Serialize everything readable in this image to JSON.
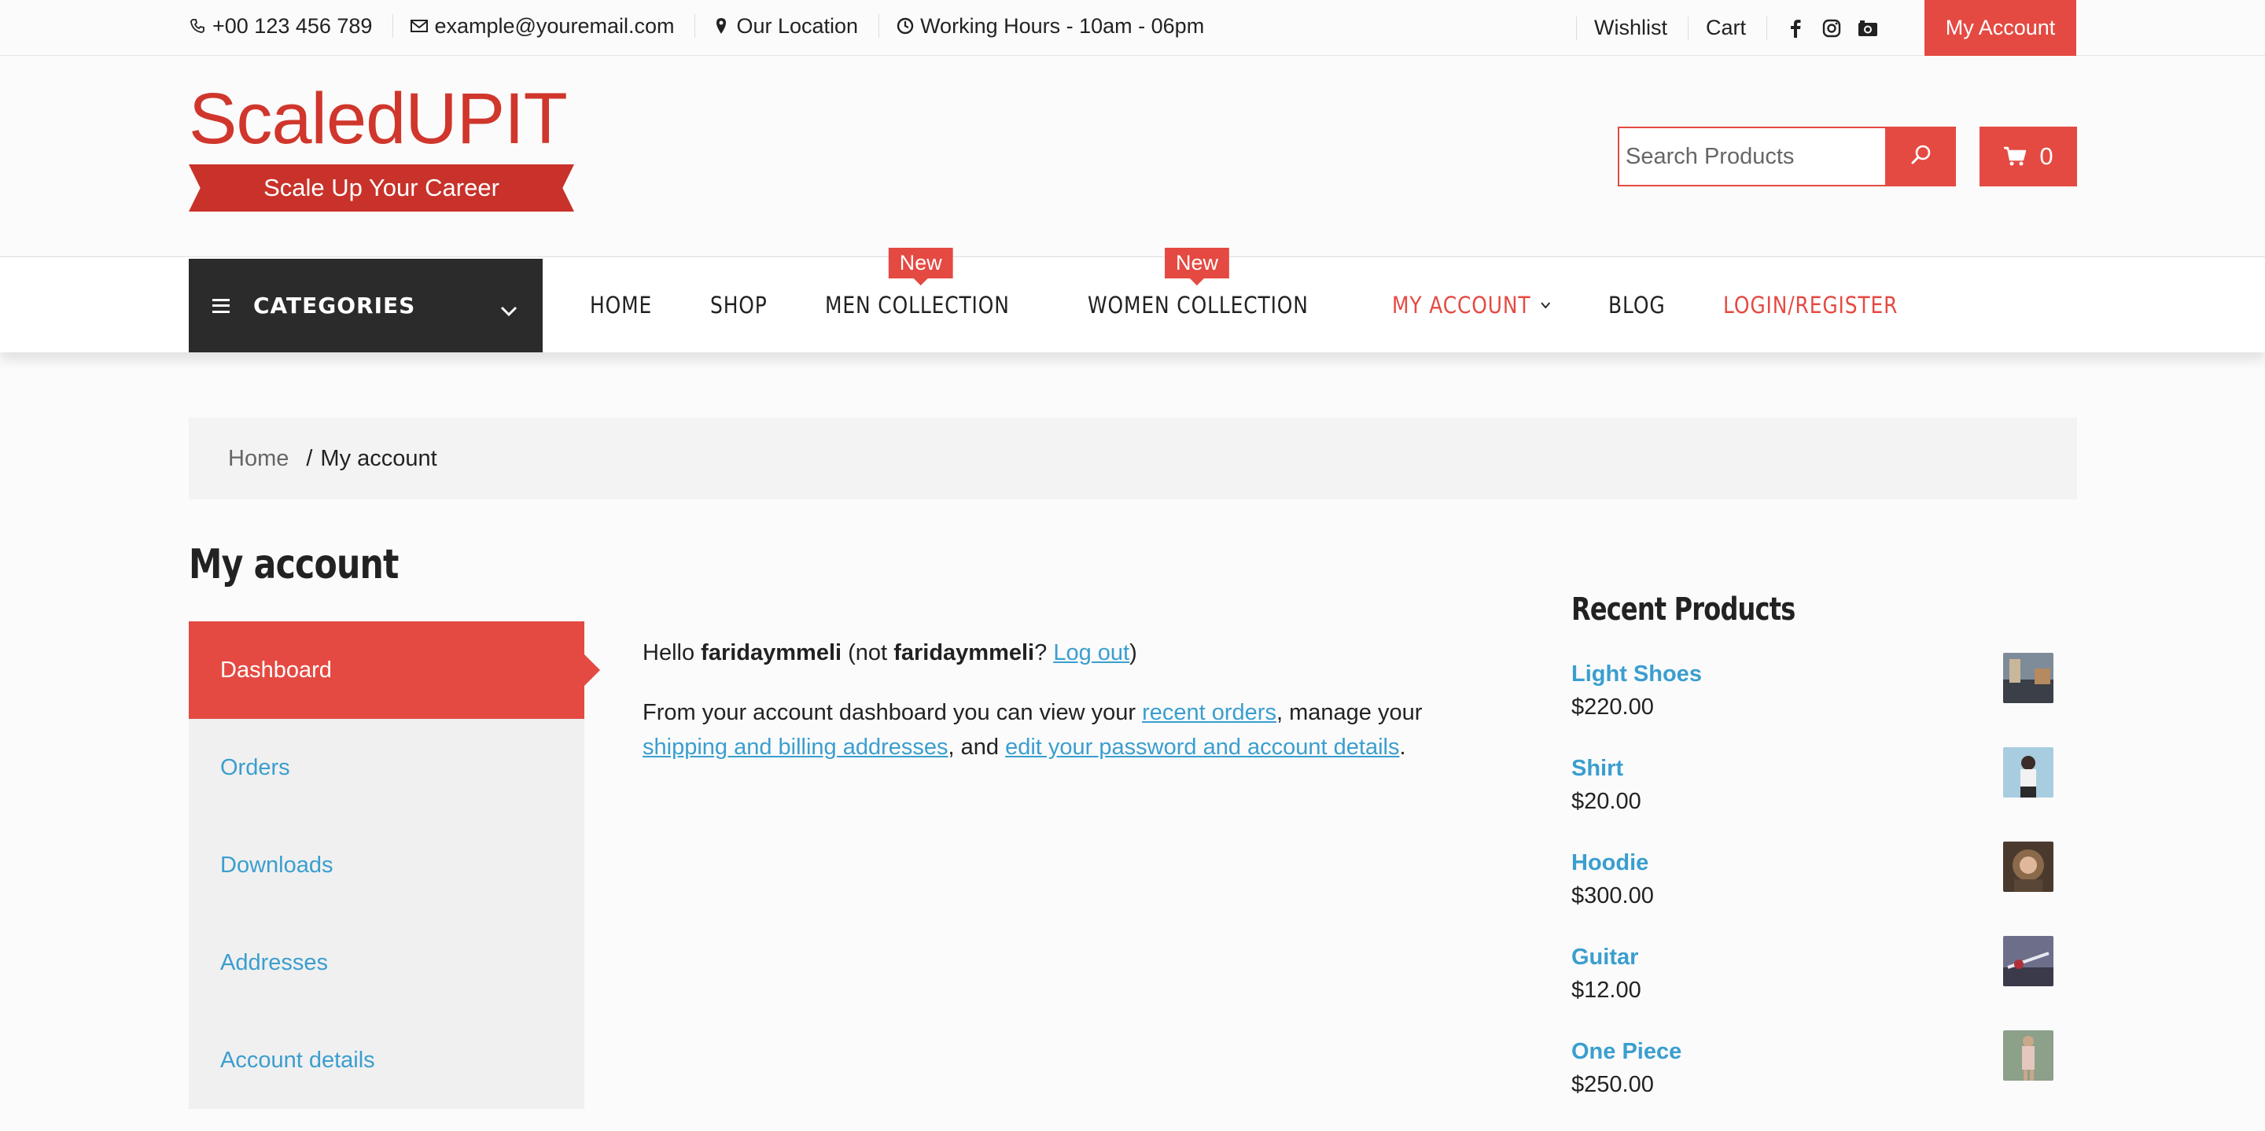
{
  "topbar": {
    "phone": "+00 123 456 789",
    "email": "example@youremail.com",
    "location": "Our Location",
    "hours": "Working Hours - 10am - 06pm",
    "wishlist": "Wishlist",
    "cart": "Cart",
    "my_account": "My Account",
    "icons": [
      "phone-icon",
      "envelope-icon",
      "map-marker-icon",
      "clock-icon",
      "facebook-icon",
      "instagram-icon",
      "camera-icon"
    ]
  },
  "header": {
    "logo_title": "ScaledUPIT",
    "logo_tagline": "Scale Up Your Career",
    "search_placeholder": "Search Products",
    "cart_count": "0"
  },
  "nav": {
    "categories_label": "CATEGORIES",
    "items": [
      {
        "label": "HOME"
      },
      {
        "label": "SHOP"
      },
      {
        "label": "MEN COLLECTION",
        "badge": "New"
      },
      {
        "label": "WOMEN COLLECTION",
        "badge": "New"
      },
      {
        "label": "MY ACCOUNT"
      },
      {
        "label": "BLOG"
      },
      {
        "label": "LOGIN/REGISTER"
      }
    ]
  },
  "breadcrumb": {
    "home": "Home",
    "separator": "/",
    "current": "My account"
  },
  "page": {
    "title": "My account"
  },
  "account_nav": {
    "items": [
      {
        "label": "Dashboard",
        "active": true
      },
      {
        "label": "Orders"
      },
      {
        "label": "Downloads"
      },
      {
        "label": "Addresses"
      },
      {
        "label": "Account details"
      }
    ]
  },
  "dashboard": {
    "hello": "Hello",
    "username": "faridaymmeli",
    "not_open": "(not",
    "username2": "faridaymmeli",
    "question": "?",
    "logout": "Log out",
    "close_paren": ")",
    "intro": "From your account dashboard you can view your",
    "recent_orders": "recent orders",
    "manage": ", manage your",
    "addresses_link": "shipping and billing addresses",
    "and": ", and",
    "details_link": "edit your password and account details",
    "period": "."
  },
  "sidebar": {
    "title": "Recent Products",
    "products": [
      {
        "name": "Light Shoes",
        "price": "$220.00"
      },
      {
        "name": "Shirt",
        "price": "$20.00"
      },
      {
        "name": "Hoodie",
        "price": "$300.00"
      },
      {
        "name": "Guitar",
        "price": "$12.00"
      },
      {
        "name": "One Piece",
        "price": "$250.00"
      }
    ]
  },
  "colors": {
    "accent": "#e44a42",
    "link": "#3a9ecf",
    "dark": "#2b2b2b"
  }
}
